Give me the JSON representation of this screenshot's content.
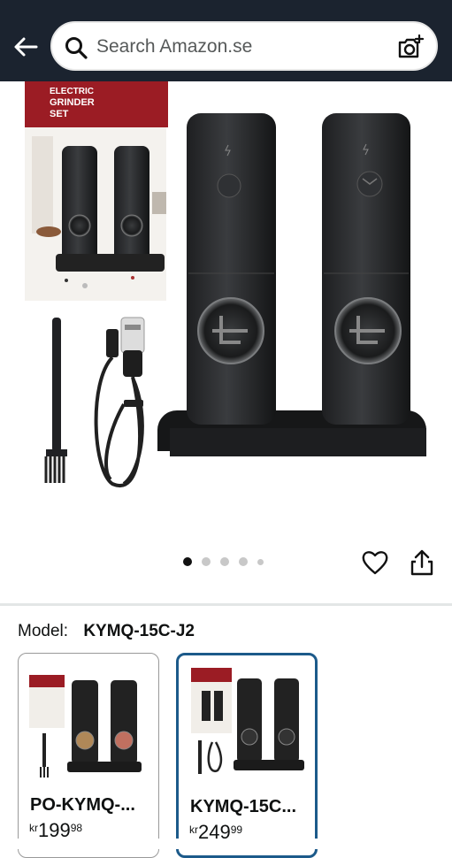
{
  "search": {
    "placeholder": "Search Amazon.se"
  },
  "gallery": {
    "box_title_line1": "ELECTRIC",
    "box_title_line2": "GRINDER",
    "box_title_line3": "SET",
    "image_count": 5,
    "active_index": 0
  },
  "model": {
    "label": "Model:",
    "value": "KYMQ-15C-J2"
  },
  "variants": [
    {
      "name": "PO-KYMQ-...",
      "currency": "kr",
      "price_whole": "199",
      "price_fraction": "98",
      "selected": false
    },
    {
      "name": "KYMQ-15C...",
      "currency": "kr",
      "price_whole": "249",
      "price_fraction": "99",
      "selected": true
    }
  ],
  "icons": {
    "back": "back-arrow-icon",
    "search": "search-icon",
    "camera": "camera-search-icon",
    "wishlist": "heart-icon",
    "share": "share-icon"
  },
  "colors": {
    "header_bg": "#1b232f",
    "selected_border": "#1c5a8a",
    "box_red": "#9b1c24"
  }
}
